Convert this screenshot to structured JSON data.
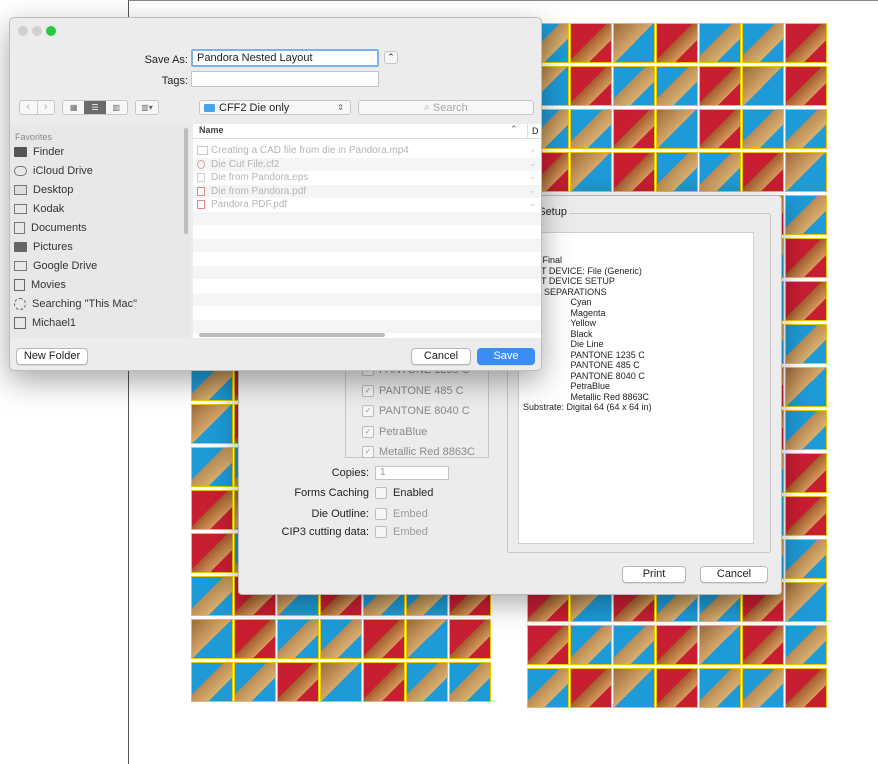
{
  "save_dialog": {
    "save_as_label": "Save As:",
    "save_as_value": "Pandora Nested Layout",
    "tags_label": "Tags:",
    "tags_value": "",
    "location": "CFF2 Die only",
    "search_placeholder": "Search",
    "sidebar_heading": "Favorites",
    "sidebar_items": [
      "Finder",
      "iCloud Drive",
      "Desktop",
      "Kodak",
      "Documents",
      "Pictures",
      "Google Drive",
      "Movies",
      "Searching \"This Mac\"",
      "Michael1"
    ],
    "column_name": "Name",
    "column_d": "D",
    "files": [
      "Creating a CAD file from die in Pandora.mp4",
      "Die Cut File.cf2",
      "Die from Pandora.eps",
      "Die from Pandora.pdf",
      "Pandora PDF.pdf"
    ],
    "new_folder": "New Folder",
    "cancel": "Cancel",
    "save": "Save",
    "accent": "#3a8df5"
  },
  "print_dialog": {
    "group_legend": "ut Setup",
    "setup_text": "ting: Final\nTPUT DEVICE: File (Generic)\nTPUT DEVICE SETUP\nLOR SEPARATIONS\n                   Cyan\n                   Magenta\n                   Yellow\n                   Black\n                   Die Line\n                   PANTONE 1235 C\n                   PANTONE 485 C\n                   PANTONE 8040 C\n                   PetraBlue\n                   Metallic Red 8863C\nSubstrate: Digital 64 (64 x 64 in)",
    "separations": [
      "PANTONE 1235 C",
      "PANTONE 485 C",
      "PANTONE 8040 C",
      "PetraBlue",
      "Metallic Red 8863C"
    ],
    "copies_label": "Copies:",
    "copies_value": "1",
    "forms_caching_label": "Forms Caching",
    "enabled_label": "Enabled",
    "die_outline_label": "Die Outline:",
    "cip3_label": "CIP3 cutting data:",
    "embed_label": "Embed",
    "print": "Print",
    "cancel": "Cancel"
  }
}
